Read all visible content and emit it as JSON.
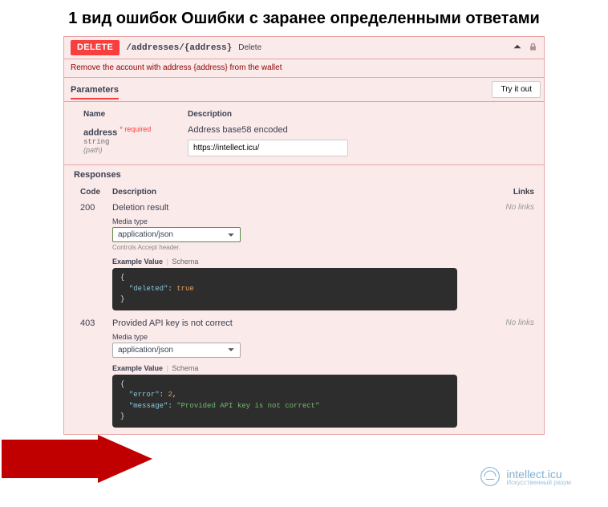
{
  "heading": "1 вид ошибок Ошибки с заранее определенными ответами",
  "op": {
    "method": "DELETE",
    "path": "/addresses/{address}",
    "short": "Delete",
    "summary": "Remove the account with address {address} from the wallet"
  },
  "parameters": {
    "sectionLabel": "Parameters",
    "tryLabel": "Try it out",
    "cols": {
      "name": "Name",
      "description": "Description"
    },
    "param": {
      "name": "address",
      "requiredMark": "* required",
      "type": "string",
      "location": "(path)",
      "description": "Address base58 encoded",
      "value": "https://intellect.icu/"
    }
  },
  "responses": {
    "sectionLabel": "Responses",
    "cols": {
      "code": "Code",
      "description": "Description",
      "links": "Links"
    },
    "mediaLabel": "Media type",
    "selectValue": "application/json",
    "controlsHint": "Controls Accept header.",
    "examplesTabs": {
      "active": "Example Value",
      "other": "Schema"
    },
    "items": [
      {
        "code": "200",
        "description": "Deletion result",
        "links": "No links",
        "example": {
          "key": "\"deleted\"",
          "value_bool": "true"
        },
        "showControlsHint": true,
        "selectStyle": "green"
      },
      {
        "code": "403",
        "description": "Provided API key is not correct",
        "links": "No links",
        "example": {
          "key1": "\"error\"",
          "val1": "2",
          "key2": "\"message\"",
          "val2": "\"Provided API key is not correct\""
        },
        "showControlsHint": false,
        "selectStyle": "plain"
      }
    ]
  },
  "watermark": {
    "main": "intellect.icu",
    "sub": "Искусственный разум"
  }
}
